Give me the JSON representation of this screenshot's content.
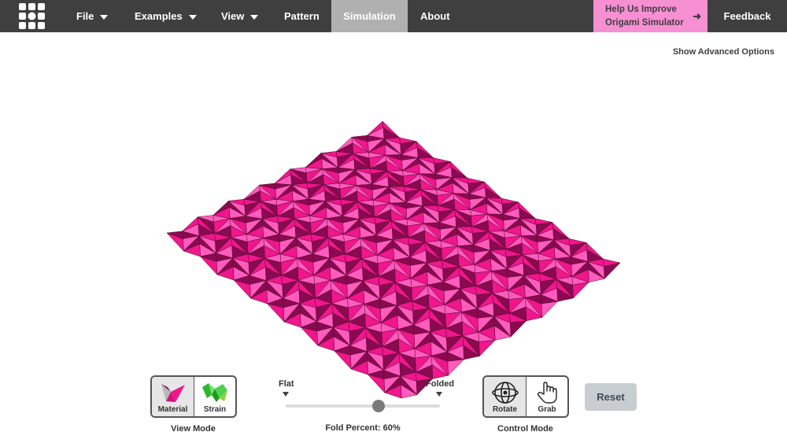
{
  "nav": {
    "menus": [
      {
        "label": "File",
        "has_caret": true
      },
      {
        "label": "Examples",
        "has_caret": true
      },
      {
        "label": "View",
        "has_caret": true
      },
      {
        "label": "Pattern",
        "has_caret": false
      },
      {
        "label": "Simulation",
        "has_caret": false,
        "active": true
      },
      {
        "label": "About",
        "has_caret": false
      }
    ],
    "help_line1": "Help Us Improve",
    "help_line2": "Origami Simulator",
    "feedback": "Feedback"
  },
  "advanced_link": "Show Advanced Options",
  "view_mode": {
    "caption": "View Mode",
    "options": [
      {
        "label": "Material",
        "icon": "material-icon",
        "selected": true
      },
      {
        "label": "Strain",
        "icon": "strain-icon",
        "selected": false
      }
    ]
  },
  "fold": {
    "left_label": "Flat",
    "right_label": "Folded",
    "caption": "Fold Percent: 60%",
    "percent": 60
  },
  "control_mode": {
    "caption": "Control Mode",
    "options": [
      {
        "label": "Rotate",
        "icon": "rotate-icon",
        "selected": true
      },
      {
        "label": "Grab",
        "icon": "hand-icon",
        "selected": false
      }
    ]
  },
  "reset_label": "Reset",
  "colors": {
    "nav_bg": "#3f3f3f",
    "help_bg": "#f78fd3",
    "model_base": "#f0168c",
    "model_light": "#ff3fb0",
    "model_dark": "#8a0a4f"
  }
}
